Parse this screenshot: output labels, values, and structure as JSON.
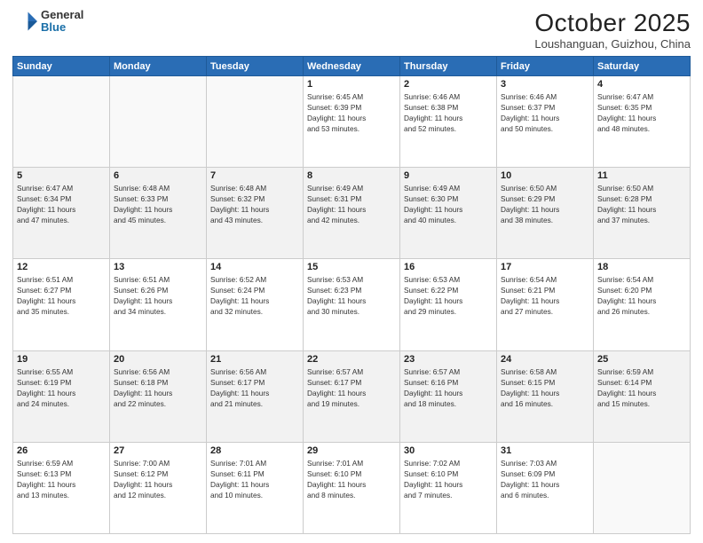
{
  "logo": {
    "general": "General",
    "blue": "Blue"
  },
  "header": {
    "month": "October 2025",
    "location": "Loushanguan, Guizhou, China"
  },
  "weekdays": [
    "Sunday",
    "Monday",
    "Tuesday",
    "Wednesday",
    "Thursday",
    "Friday",
    "Saturday"
  ],
  "weeks": [
    [
      {
        "day": "",
        "info": ""
      },
      {
        "day": "",
        "info": ""
      },
      {
        "day": "",
        "info": ""
      },
      {
        "day": "1",
        "info": "Sunrise: 6:45 AM\nSunset: 6:39 PM\nDaylight: 11 hours\nand 53 minutes."
      },
      {
        "day": "2",
        "info": "Sunrise: 6:46 AM\nSunset: 6:38 PM\nDaylight: 11 hours\nand 52 minutes."
      },
      {
        "day": "3",
        "info": "Sunrise: 6:46 AM\nSunset: 6:37 PM\nDaylight: 11 hours\nand 50 minutes."
      },
      {
        "day": "4",
        "info": "Sunrise: 6:47 AM\nSunset: 6:35 PM\nDaylight: 11 hours\nand 48 minutes."
      }
    ],
    [
      {
        "day": "5",
        "info": "Sunrise: 6:47 AM\nSunset: 6:34 PM\nDaylight: 11 hours\nand 47 minutes."
      },
      {
        "day": "6",
        "info": "Sunrise: 6:48 AM\nSunset: 6:33 PM\nDaylight: 11 hours\nand 45 minutes."
      },
      {
        "day": "7",
        "info": "Sunrise: 6:48 AM\nSunset: 6:32 PM\nDaylight: 11 hours\nand 43 minutes."
      },
      {
        "day": "8",
        "info": "Sunrise: 6:49 AM\nSunset: 6:31 PM\nDaylight: 11 hours\nand 42 minutes."
      },
      {
        "day": "9",
        "info": "Sunrise: 6:49 AM\nSunset: 6:30 PM\nDaylight: 11 hours\nand 40 minutes."
      },
      {
        "day": "10",
        "info": "Sunrise: 6:50 AM\nSunset: 6:29 PM\nDaylight: 11 hours\nand 38 minutes."
      },
      {
        "day": "11",
        "info": "Sunrise: 6:50 AM\nSunset: 6:28 PM\nDaylight: 11 hours\nand 37 minutes."
      }
    ],
    [
      {
        "day": "12",
        "info": "Sunrise: 6:51 AM\nSunset: 6:27 PM\nDaylight: 11 hours\nand 35 minutes."
      },
      {
        "day": "13",
        "info": "Sunrise: 6:51 AM\nSunset: 6:26 PM\nDaylight: 11 hours\nand 34 minutes."
      },
      {
        "day": "14",
        "info": "Sunrise: 6:52 AM\nSunset: 6:24 PM\nDaylight: 11 hours\nand 32 minutes."
      },
      {
        "day": "15",
        "info": "Sunrise: 6:53 AM\nSunset: 6:23 PM\nDaylight: 11 hours\nand 30 minutes."
      },
      {
        "day": "16",
        "info": "Sunrise: 6:53 AM\nSunset: 6:22 PM\nDaylight: 11 hours\nand 29 minutes."
      },
      {
        "day": "17",
        "info": "Sunrise: 6:54 AM\nSunset: 6:21 PM\nDaylight: 11 hours\nand 27 minutes."
      },
      {
        "day": "18",
        "info": "Sunrise: 6:54 AM\nSunset: 6:20 PM\nDaylight: 11 hours\nand 26 minutes."
      }
    ],
    [
      {
        "day": "19",
        "info": "Sunrise: 6:55 AM\nSunset: 6:19 PM\nDaylight: 11 hours\nand 24 minutes."
      },
      {
        "day": "20",
        "info": "Sunrise: 6:56 AM\nSunset: 6:18 PM\nDaylight: 11 hours\nand 22 minutes."
      },
      {
        "day": "21",
        "info": "Sunrise: 6:56 AM\nSunset: 6:17 PM\nDaylight: 11 hours\nand 21 minutes."
      },
      {
        "day": "22",
        "info": "Sunrise: 6:57 AM\nSunset: 6:17 PM\nDaylight: 11 hours\nand 19 minutes."
      },
      {
        "day": "23",
        "info": "Sunrise: 6:57 AM\nSunset: 6:16 PM\nDaylight: 11 hours\nand 18 minutes."
      },
      {
        "day": "24",
        "info": "Sunrise: 6:58 AM\nSunset: 6:15 PM\nDaylight: 11 hours\nand 16 minutes."
      },
      {
        "day": "25",
        "info": "Sunrise: 6:59 AM\nSunset: 6:14 PM\nDaylight: 11 hours\nand 15 minutes."
      }
    ],
    [
      {
        "day": "26",
        "info": "Sunrise: 6:59 AM\nSunset: 6:13 PM\nDaylight: 11 hours\nand 13 minutes."
      },
      {
        "day": "27",
        "info": "Sunrise: 7:00 AM\nSunset: 6:12 PM\nDaylight: 11 hours\nand 12 minutes."
      },
      {
        "day": "28",
        "info": "Sunrise: 7:01 AM\nSunset: 6:11 PM\nDaylight: 11 hours\nand 10 minutes."
      },
      {
        "day": "29",
        "info": "Sunrise: 7:01 AM\nSunset: 6:10 PM\nDaylight: 11 hours\nand 8 minutes."
      },
      {
        "day": "30",
        "info": "Sunrise: 7:02 AM\nSunset: 6:10 PM\nDaylight: 11 hours\nand 7 minutes."
      },
      {
        "day": "31",
        "info": "Sunrise: 7:03 AM\nSunset: 6:09 PM\nDaylight: 11 hours\nand 6 minutes."
      },
      {
        "day": "",
        "info": ""
      }
    ]
  ]
}
